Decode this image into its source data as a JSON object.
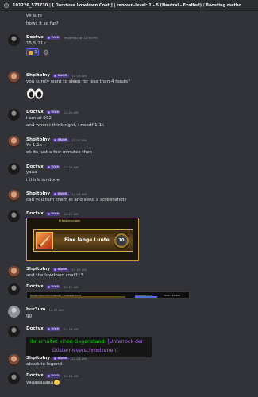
{
  "channel": {
    "title": "101226_573730 | [ Darkfuse Lowdown Coat ] | renown-level: 1 - 5 (Neutral - Exalted) / Boosting metho"
  },
  "messages": [
    {
      "lines": [
        "ye sure",
        "hows it so far?"
      ]
    },
    {
      "user": "Doctvx",
      "badge": "VOID",
      "time": "Yesterday at 11:59 PM",
      "lines": [
        "15,5/21k"
      ],
      "reaction_count": "1"
    },
    {
      "user": "Shpitolny",
      "badge": "RAWR",
      "time": "12:19 AM",
      "lines": [
        "you surely want to sleep for less than 4 hours?"
      ]
    },
    {
      "user": "Doctvx",
      "badge": "VOID",
      "time": "12:20 AM",
      "lines": [
        "i am at 992",
        "and when i think right, i needf 1,1k"
      ]
    },
    {
      "user": "Shpitolny",
      "badge": "RAWR",
      "time": "12:20 AM",
      "lines": [
        "Ye 1,1k",
        "ok its just a few minutes then"
      ]
    },
    {
      "user": "Doctvx",
      "badge": "VOID",
      "time": "12:20 AM",
      "lines": [
        "yaaa",
        "i think im done"
      ]
    },
    {
      "user": "Shpitolny",
      "badge": "RAWR",
      "time": "12:26 AM",
      "lines": [
        "can you turn them in and send a screenshot?"
      ]
    },
    {
      "user": "Doctvx",
      "badge": "VOID",
      "time": "12:27 AM",
      "achievement": {
        "header": "Erfolg errungen",
        "name": "Eine lange Lunte",
        "points": "10"
      }
    },
    {
      "user": "Shpitolny",
      "badge": "RAWR",
      "time": "12:27 AM",
      "lines": [
        "and the lowdown coat? :3"
      ]
    },
    {
      "user": "Doctvx",
      "badge": "VOID",
      "time": "12:27 AM",
      "tooltip": {
        "left": "Düsternisverschmolzenen | Ausgezeichnet",
        "mid": "Ausgezeichnet",
        "right": "7000 / 10.000"
      }
    },
    {
      "user": "bur3um",
      "time": "12:27 AM",
      "lines": [
        "gg"
      ]
    },
    {
      "user": "Doctvx",
      "badge": "VOID",
      "time": "12:28 AM",
      "loot": {
        "prefix": "Ihr erhaltet einen Gegenstand: ",
        "item": "[Unterrock der",
        "item2": "Düsternisverschmolzenen]"
      }
    },
    {
      "user": "Shpitolny",
      "badge": "RAWR",
      "time": "12:28 AM",
      "lines": [
        "absolute legend"
      ]
    },
    {
      "user": "Doctvx",
      "badge": "VOID",
      "time": "12:28 AM",
      "lines": [
        "yaaaaaaaaa"
      ]
    }
  ]
}
